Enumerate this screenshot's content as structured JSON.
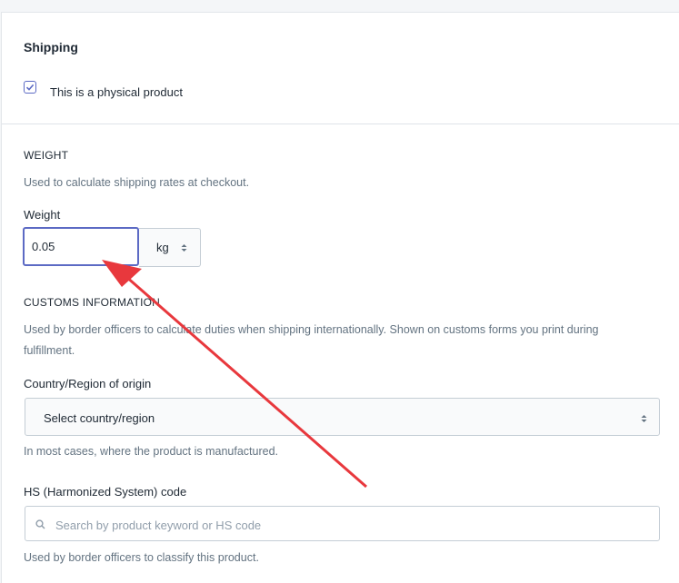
{
  "shipping": {
    "title": "Shipping",
    "physical_product_label": "This is a physical product",
    "physical_product_checked": true
  },
  "weight": {
    "heading": "WEIGHT",
    "help": "Used to calculate shipping rates at checkout.",
    "label": "Weight",
    "value": "0.05",
    "unit": "kg"
  },
  "customs": {
    "heading": "CUSTOMS INFORMATION",
    "help_line1": "Used by border officers to calculate duties when shipping internationally. Shown on customs forms you print during",
    "help_line2": "fulfillment.",
    "country_label": "Country/Region of origin",
    "country_value": "Select country/region",
    "country_help": "In most cases, where the product is manufactured.",
    "hs_label": "HS (Harmonized System) code",
    "hs_placeholder": "Search by product keyword or HS code",
    "hs_help": "Used by border officers to classify this product."
  },
  "colors": {
    "accent": "#5c6ac4",
    "annotation_arrow": "#e8383d"
  },
  "icons": {
    "checkbox": "checkmark-icon",
    "select": "select-arrows-icon",
    "search": "search-icon",
    "annotation": "arrow-annotation"
  }
}
